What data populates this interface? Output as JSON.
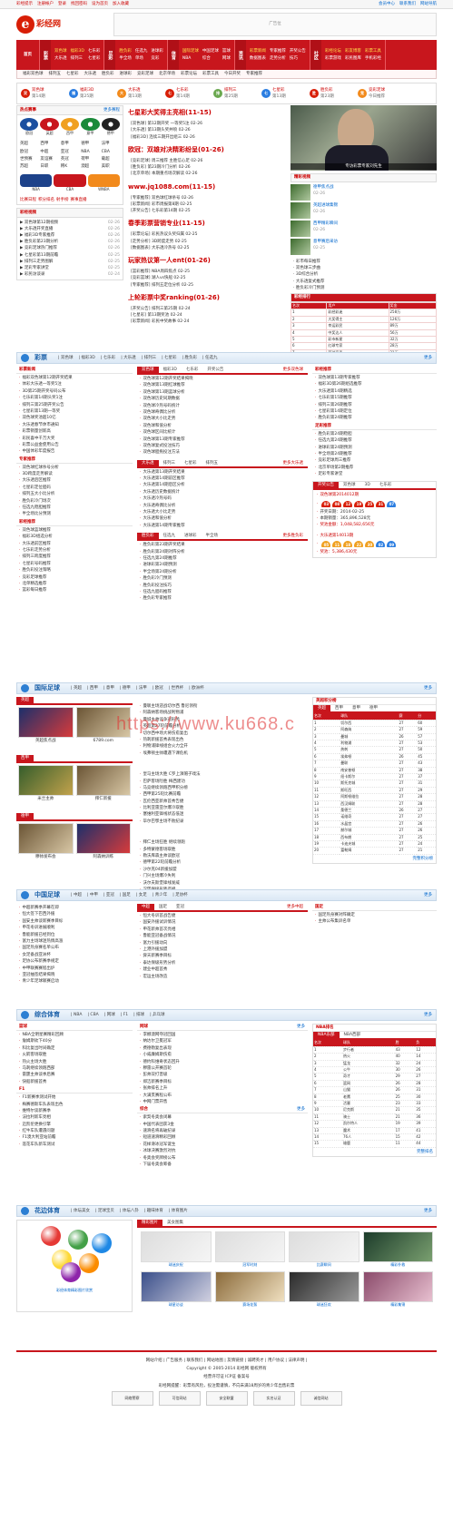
{
  "topbar": {
    "links": [
      "彩经提示",
      "注册帐户",
      "登录",
      "找回密码",
      "设为首页",
      "加入收藏"
    ],
    "right": [
      "会员中心",
      "联系我们",
      "网站导航"
    ]
  },
  "logo": {
    "text": "彩经网"
  },
  "banner": {
    "text": "广告位"
  },
  "nav": {
    "home": "首页",
    "groups": [
      {
        "head": "彩票",
        "items": [
          "双色球",
          "福彩3D",
          "七乐彩",
          "大乐透",
          "排列三",
          "七星彩"
        ],
        "hl": [
          0,
          1
        ]
      },
      {
        "head": "足彩",
        "items": [
          "胜负彩",
          "任选九",
          "进球彩",
          "半全场",
          "单场",
          "竞彩"
        ],
        "hl": [
          0
        ]
      },
      {
        "head": "体育",
        "items": [
          "国际足球",
          "中国足球",
          "篮球",
          "NBA",
          "综合",
          "网球"
        ],
        "hl": [
          0
        ]
      },
      {
        "head": "资讯",
        "items": [
          "彩票新闻",
          "专家推荐",
          "开奖公告",
          "数据图表",
          "走势分析",
          "技巧"
        ],
        "hl": [
          0
        ]
      },
      {
        "head": "社区",
        "items": [
          "彩经论坛",
          "彩友博客",
          "彩票工具",
          "彩票游戏",
          "彩民图库",
          "手机彩经"
        ],
        "hl": [
          0,
          1,
          2
        ]
      }
    ]
  },
  "subnav": [
    "福彩双色球",
    "排列五",
    "七星彩",
    "大乐透",
    "胜负彩",
    "进球彩",
    "竞彩足球",
    "北京单场",
    "彩票论坛",
    "彩票工具",
    "今日开奖",
    "专家推荐"
  ],
  "lotto": [
    {
      "name": "双色球",
      "issue": "第14期",
      "color": "#d81e06"
    },
    {
      "name": "福彩3D",
      "issue": "第25期",
      "color": "#2a7de1"
    },
    {
      "name": "大乐透",
      "issue": "第13期",
      "color": "#f28a1c"
    },
    {
      "name": "七乐彩",
      "issue": "第14期",
      "color": "#d81e06"
    },
    {
      "name": "排列三",
      "issue": "第25期",
      "color": "#6aa84f"
    },
    {
      "name": "七星彩",
      "issue": "第13期",
      "color": "#2a7de1"
    },
    {
      "name": "胜负彩",
      "issue": "第23期",
      "color": "#d81e06"
    },
    {
      "name": "竞彩足球",
      "issue": "今日推荐",
      "color": "#f28a1c"
    }
  ],
  "hot": {
    "title": "热点赛事",
    "more": "更多赛程",
    "teams": [
      "欧冠",
      "英超",
      "西甲",
      "意甲",
      "德甲"
    ],
    "leagues": [
      "英超",
      "西甲",
      "意甲",
      "德甲",
      "法甲",
      "欧冠",
      "中超",
      "亚冠",
      "NBA",
      "CBA",
      "世预赛",
      "友谊赛",
      "英冠",
      "荷甲",
      "葡超",
      "苏超",
      "日职",
      "韩K",
      "澳超",
      "美职"
    ],
    "nba": [
      "NBA",
      "CBA",
      "WNBA"
    ],
    "extra": [
      "比赛日程",
      "积分排名",
      "射手榜",
      "赛事直播"
    ],
    "shop": {
      "title": "彩经视频",
      "items": [
        [
          "双色球第12期视频",
          "02-26"
        ],
        [
          "大乐透开奖直播",
          "02-26"
        ],
        [
          "福彩3D专家推荐",
          "02-26"
        ],
        [
          "胜负彩第23期分析",
          "02-26"
        ],
        [
          "竞彩足球热门推荐",
          "02-26"
        ],
        [
          "七星彩第13期前瞻",
          "02-25"
        ],
        [
          "排列三走势图解",
          "02-25"
        ],
        [
          "足彩专家讲堂",
          "02-25"
        ],
        [
          "彩民访谈录",
          "02-24"
        ]
      ]
    }
  },
  "headlines": [
    {
      "title": "七星彩大奖得主亮相(11-15)",
      "items": [
        "[双色球] 第12期开奖 一等奖5注 02-26",
        "[大乐透] 第13期头奖井喷 02-26",
        "[福彩3D] 连续三期开出组三 02-26"
      ]
    },
    {
      "title": "欧冠：双雄对决精彩纷呈(01-26)",
      "items": [
        "[竞彩足球] 周三推荐 主胜信心足 02-26",
        "[胜负彩] 第23期冷门分析 02-26",
        "[北京单场] 本期重点场次解读 02-26"
      ]
    },
    {
      "title": "www.jq1088.com(11-15)",
      "items": [
        "[专家推荐] 双色球红球杀号 02-26",
        "[彩票新闻] 彩市周报第8期 02-25",
        "[开奖公告] 七乐彩第14期 02-25"
      ]
    },
    {
      "title": "春季彩票营销专业(11-15)",
      "items": [
        "[彩票论坛] 彩民热议头奖归属 02-25",
        "[走势分析] 3D跨度走势 02-25",
        "[数据图表] 大乐透冷热号 02-25"
      ]
    },
    {
      "title": "玩家热议第一人ent(01-26)",
      "items": [
        "[篮彩推荐] NBA周四焦点 02-25",
        "[竞彩篮球] 湖人vs快船 02-25",
        "[专家推荐] 排列五定位分析 02-25"
      ]
    },
    {
      "title": "上轮彩票中奖ranking(01-26)",
      "items": [
        "[开奖公告] 排列三第25期 02-24",
        "[七星彩] 第13期奖池 02-24",
        "[彩票新闻] 彩民中奖故事 02-24"
      ]
    }
  ],
  "photo": {
    "caption": "专访彩票专家刘先生"
  },
  "video": {
    "title": "精彩视频",
    "items": [
      [
        "德甲焦点战",
        "02-26"
      ],
      [
        "英超进球集锦",
        "02-26"
      ],
      [
        "西甲精彩瞬间",
        "02-26"
      ],
      [
        "意甲赛后采访",
        "02-25"
      ]
    ]
  },
  "rank": {
    "title": "彩经排行",
    "cols": [
      "名次",
      "用户",
      "奖金"
    ],
    "rows": [
      [
        "1",
        "彩经彩迷",
        "258万"
      ],
      [
        "2",
        "大奖得主",
        "126万"
      ],
      [
        "3",
        "幸运彩民",
        "89万"
      ],
      [
        "4",
        "中奖达人",
        "56万"
      ],
      [
        "5",
        "彩市新星",
        "32万"
      ],
      [
        "6",
        "红球专家",
        "28万"
      ],
      [
        "7",
        "蓝球高手",
        "21万"
      ]
    ]
  },
  "list1": [
    "彩市每日推荐",
    "双色球三步曲",
    "3D综合分析",
    "大乐透复式推荐",
    "胜负彩冷门预测"
  ],
  "sec_lottery": {
    "title": "彩票",
    "links": [
      "双色球",
      "福彩3D",
      "七乐彩",
      "大乐透",
      "排列三",
      "七星彩",
      "胜负彩",
      "任选九"
    ],
    "more": "更多",
    "left": [
      {
        "head": "彩票新闻",
        "items": [
          "福彩双色球第12期开奖结果",
          "体彩大乐透一等奖5注",
          "3D第25期开奖号码公布",
          "七乐彩第14期头奖1注",
          "排列三第25期开奖公告",
          "七星彩第13期一等奖",
          "双色球奖池超10亿",
          "大乐透春节休市通知",
          "彩票销量创新高",
          "彩民喜中千万大奖",
          "彩票公益金使用公告",
          "中国体彩年度报告"
        ]
      },
      {
        "head": "专家推荐",
        "items": [
          "双色球红球杀号分析",
          "3D跨度走势解读",
          "大乐透后区推荐",
          "七星彩定位胆码",
          "排列五大小比分析",
          "胜负彩冷门场次",
          "任选九稳胆推荐",
          "半全场比分预测"
        ]
      },
      {
        "head": "彩经推荐",
        "items": [
          "双色球蓝球推荐",
          "福彩3D组选分析",
          "大乐透前区推荐",
          "七乐彩走势分析",
          "排列三跨度推荐",
          "七星彩号码推荐",
          "胜负彩投注策略",
          "竞彩足球推荐",
          "北单精选推荐",
          "篮彩每日推荐"
        ]
      }
    ],
    "mid": [
      {
        "tabs": [
          "双色球",
          "福彩3D",
          "七乐彩",
          "开奖公告"
        ],
        "more": "更多双色球",
        "items": [
          "双色球第12期开奖结果揭晓",
          "双色球第13期红球推荐",
          "双色球第13期蓝球分析",
          "双色球历史同期数据",
          "双色球冷热号码统计",
          "双色球奇偶比分析",
          "双色球大小比走势",
          "双色球和值分析",
          "双色球区间比统计",
          "双色球第13期专家推荐",
          "双色球复式投注技巧",
          "双色球胆拖投注方法"
        ]
      },
      {
        "tabs": [
          "大乐透",
          "排列三",
          "七星彩",
          "排列五"
        ],
        "more": "更多大乐透",
        "items": [
          "大乐透第13期开奖结果",
          "大乐透第14期前区推荐",
          "大乐透第14期后区分析",
          "大乐透历史数据统计",
          "大乐透冷热号码",
          "大乐透奇偶比分析",
          "大乐透大小比走势",
          "大乐透和值分析",
          "大乐透第14期专家推荐"
        ]
      },
      {
        "tabs": [
          "胜负彩",
          "任选九",
          "进球彩",
          "半全场"
        ],
        "more": "更多胜负彩",
        "items": [
          "胜负彩第23期开奖结果",
          "胜负彩第24期对阵分析",
          "任选九第24期推荐",
          "进球彩第24期预测",
          "半全场第24期分析",
          "胜负彩冷门预测",
          "胜负彩投注技巧",
          "任选九胆码推荐",
          "胜负彩专家推荐"
        ]
      }
    ],
    "right": [
      {
        "head": "彩经推荐",
        "items": [
          "双色球第13期专家推荐",
          "福彩3D第26期组选推荐",
          "大乐透第14期精选",
          "七乐彩第15期推荐",
          "排列三第26期推荐",
          "七星彩第14期定位",
          "胜负彩第24期推荐"
        ]
      },
      {
        "head": "足彩推荐",
        "items": [
          "胜负彩第24期稳胆",
          "任选九第24期推荐",
          "进球彩第24期预测",
          "半全场第24期推荐",
          "竞彩足球周三推荐",
          "北京单场第2期推荐",
          "足彩专家讲堂"
        ]
      },
      {
        "head": "开奖公告",
        "tabs": [
          "双色球",
          "3D",
          "七乐彩"
        ],
        "issue": "双色球第2014012期",
        "date": "开奖日期：2014-02-25",
        "reds": [
          "03",
          "08",
          "12",
          "19",
          "25",
          "31"
        ],
        "blue": "07",
        "sales": "本期销量：365,896,528元",
        "pool": "奖池金额：1,048,582,656元",
        "issue2": "大乐透第14013期",
        "reds2": [
          "05",
          "11",
          "18",
          "22",
          "30"
        ],
        "blues2": [
          "02",
          "09"
        ],
        "pool2": "奖池：5,386,430元"
      }
    ]
  },
  "sec_intl": {
    "title": "国际足球",
    "links": [
      "英超",
      "西甲",
      "意甲",
      "德甲",
      "法甲",
      "欧冠",
      "世界杯",
      "欧洲杯"
    ],
    "more": "更多",
    "pics": [
      {
        "cap": "英超焦点战"
      },
      {
        "cap": "6789.com"
      }
    ],
    "pics2": [
      {
        "cap": "米兰主帅"
      },
      {
        "cap": "拜仁新援"
      }
    ],
    "pics3": [
      {
        "cap": "穆帅发布会"
      },
      {
        "cap": "阿森纳训练"
      }
    ],
    "head1": "英超",
    "head2": "西甲",
    "head3": "德甲",
    "items1": [
      "曼联主场迎战切尔西 鲁尼领衔",
      "阿森纳客场挑战利物浦",
      "曼城主帅谈争冠形势",
      "英超第27轮前瞻分析",
      "切尔西中场大将伤愈复出",
      "热刺新援首秀表现出色",
      "利物浦锋线组合火力全开",
      "埃弗顿主帅遭遇下课危机"
    ],
    "items2": [
      "皇马主场大胜 C罗上演帽子戏法",
      "巴萨客场险胜 梅西建功",
      "马竞继续领跑西甲积分榜",
      "西甲第25轮比赛前瞻",
      "瓦伦西亚新帅首秀告捷",
      "比利亚雷亚尔爆冷取胜",
      "塞维利亚锋线状态低迷",
      "毕尔巴鄂主场不败纪录"
    ],
    "items3": [
      "拜仁主场狂胜 继续领跑",
      "多特蒙德客场取胜",
      "勒沃库森主帅谈欧冠",
      "德甲第22轮前瞻分析",
      "沙尔克04新援加盟",
      "门兴主场爆冷失利",
      "沃尔夫斯堡锋线发威",
      "汉堡保级形势严峻"
    ],
    "stand": {
      "title": "英超积分榜",
      "tabs": [
        "英超",
        "西甲",
        "意甲",
        "德甲"
      ],
      "cols": [
        "名次",
        "球队",
        "赛",
        "分"
      ],
      "rows": [
        [
          "1",
          "切尔西",
          "27",
          "60"
        ],
        [
          "2",
          "阿森纳",
          "27",
          "59"
        ],
        [
          "3",
          "曼城",
          "26",
          "57"
        ],
        [
          "4",
          "利物浦",
          "27",
          "53"
        ],
        [
          "5",
          "热刺",
          "27",
          "50"
        ],
        [
          "6",
          "埃弗顿",
          "26",
          "45"
        ],
        [
          "7",
          "曼联",
          "27",
          "43"
        ],
        [
          "8",
          "南安普顿",
          "27",
          "38"
        ],
        [
          "9",
          "纽卡斯尔",
          "27",
          "37"
        ],
        [
          "10",
          "斯托克城",
          "27",
          "31"
        ],
        [
          "11",
          "斯旺西",
          "27",
          "29"
        ],
        [
          "12",
          "阿斯顿维拉",
          "27",
          "28"
        ],
        [
          "13",
          "西汉姆联",
          "27",
          "28"
        ],
        [
          "14",
          "桑德兰",
          "26",
          "27"
        ],
        [
          "15",
          "诺维奇",
          "27",
          "27"
        ],
        [
          "16",
          "水晶宫",
          "27",
          "26"
        ],
        [
          "17",
          "赫尔城",
          "27",
          "26"
        ],
        [
          "18",
          "西布朗",
          "27",
          "25"
        ],
        [
          "19",
          "卡迪夫城",
          "27",
          "24"
        ],
        [
          "20",
          "富勒姆",
          "27",
          "21"
        ]
      ],
      "more": "完整积分榜"
    }
  },
  "sec_china": {
    "title": "中国足球",
    "links": [
      "中超",
      "中甲",
      "亚冠",
      "国足",
      "女足",
      "青少年",
      "足协杯"
    ],
    "more": "更多",
    "left": [
      "中超新赛季开幕在即",
      "恒大签下巴西外援",
      "国安主帅谈新赛季目标",
      "申花冬训进展顺利",
      "鲁能新援已经到位",
      "富力主场球迷热情高涨",
      "国足热身赛名单公布",
      "女足备战亚洲杯",
      "足协公布新赛季规定",
      "中甲联赛赛程出炉",
      "亚冠抽签结果揭晓",
      "青少年足球联赛启动"
    ],
    "mid": {
      "tabs": [
        "中超",
        "国足",
        "亚冠"
      ],
      "more": "更多中超",
      "items": [
        "恒大冬训首战告捷",
        "国安外援试训情况",
        "申花新帅首次亮相",
        "鲁能亚冠备战情况",
        "富力引援动向",
        "上港外援加盟",
        "舜天新赛季目标",
        "泰达保级形势分析",
        "建业中超首秀",
        "宏运主场改造"
      ]
    },
    "right": {
      "head": "国足",
      "items": [
        "国足热身赛对阵确定",
        "主帅公布集训名单"
      ]
    }
  },
  "sec_sport": {
    "title": "综合体育",
    "links": [
      "NBA",
      "CBA",
      "网球",
      "F1",
      "排球",
      "乒乓球"
    ],
    "more": "更多",
    "left": [
      {
        "head": "篮球",
        "items": [
          "NBA全明星赛精彩回顾",
          "詹姆斯砍下40分",
          "科比复出时间确定",
          "火箭客场取胜",
          "热火主场大胜",
          "马刺继续领跑西部",
          "雷霆主帅谈季后赛",
          "快船新援首秀"
        ]
      },
      {
        "head": "F1",
        "items": [
          "F1新赛季测试开始",
          "梅赛德斯车队表现出色",
          "维特尔谈新赛季",
          "法拉利新车亮相",
          "迈凯伦更换引擎",
          "红牛车队遭遇问题",
          "F1澳大利亚站前瞻",
          "莲花车队新车测试"
        ]
      }
    ],
    "mid": [
      {
        "head": "网球",
        "more": "更多",
        "items": [
          "李娜澳网夺冠回国",
          "纳达尔卫冕冠军",
          "费德勒复出表现",
          "小威廉姆斯伤愈",
          "德约科维奇状态回升",
          "穆雷公开赛首轮",
          "彭帅双打晋级",
          "郑洁新赛季目标",
          "张帅排名上升",
          "大满贯赛程公布",
          "中网门票开售"
        ]
      },
      {
        "head": "综合",
        "more": "更多",
        "items": [
          "索契冬奥会闭幕",
          "中国代表团获3金",
          "速滑名将再破纪录",
          "短道速滑精彩回顾",
          "花样滑冰冠军诞生",
          "冰球决赛激烈对抗",
          "冬奥会奖牌榜公布",
          "下届冬奥会筹备"
        ]
      }
    ],
    "stand": {
      "title": "NBA排名",
      "tabs": [
        "NBA东部",
        "NBA西部"
      ],
      "cols": [
        "名次",
        "球队",
        "胜",
        "负"
      ],
      "rows": [
        [
          "1",
          "步行者",
          "43",
          "12"
        ],
        [
          "2",
          "热火",
          "40",
          "14"
        ],
        [
          "3",
          "猛龙",
          "32",
          "24"
        ],
        [
          "4",
          "公牛",
          "30",
          "26"
        ],
        [
          "5",
          "奇才",
          "29",
          "27"
        ],
        [
          "6",
          "篮网",
          "26",
          "28"
        ],
        [
          "7",
          "山猫",
          "26",
          "31"
        ],
        [
          "8",
          "老鹰",
          "25",
          "30"
        ],
        [
          "9",
          "活塞",
          "23",
          "33"
        ],
        [
          "10",
          "尼克斯",
          "21",
          "35"
        ],
        [
          "11",
          "骑士",
          "21",
          "36"
        ],
        [
          "12",
          "凯尔特人",
          "19",
          "39"
        ],
        [
          "13",
          "魔术",
          "17",
          "41"
        ],
        [
          "14",
          "76人",
          "15",
          "42"
        ],
        [
          "15",
          "雄鹿",
          "11",
          "44"
        ]
      ],
      "more": "完整排名"
    }
  },
  "sec_flower": {
    "title": "花边体育",
    "links": [
      "体坛美女",
      "足球宝贝",
      "体坛八卦",
      "趣味体育",
      "体育图片"
    ],
    "more": "更多",
    "bigcap": "彩经体育精彩图片欣赏",
    "tabs": [
      "精彩图片",
      "美女图集"
    ],
    "caps": [
      "球迷庆祝",
      "冠军时刻",
      "比赛瞬间",
      "精彩扑救",
      "球星访谈",
      "赛场花絮",
      "球迷狂欢",
      "精彩集锦"
    ]
  },
  "watermark": "https://www.ku668.c",
  "footer": {
    "links": [
      "网站介绍",
      "广告服务",
      "联系我们",
      "网站地图",
      "友情链接",
      "诚聘英才",
      "用户协议",
      "法律声明"
    ],
    "copy": "Copyright © 2005-2014 彩经网 版权所有",
    "icp": "经营许可证 ICP证 备案号",
    "note": "彩经网提醒：彩票有风险，投注需谨慎，不向未满18周岁的青少年出售彩票",
    "badges": [
      "网络警察",
      "可信网站",
      "安全联盟",
      "实名认证",
      "诚信网站"
    ]
  }
}
